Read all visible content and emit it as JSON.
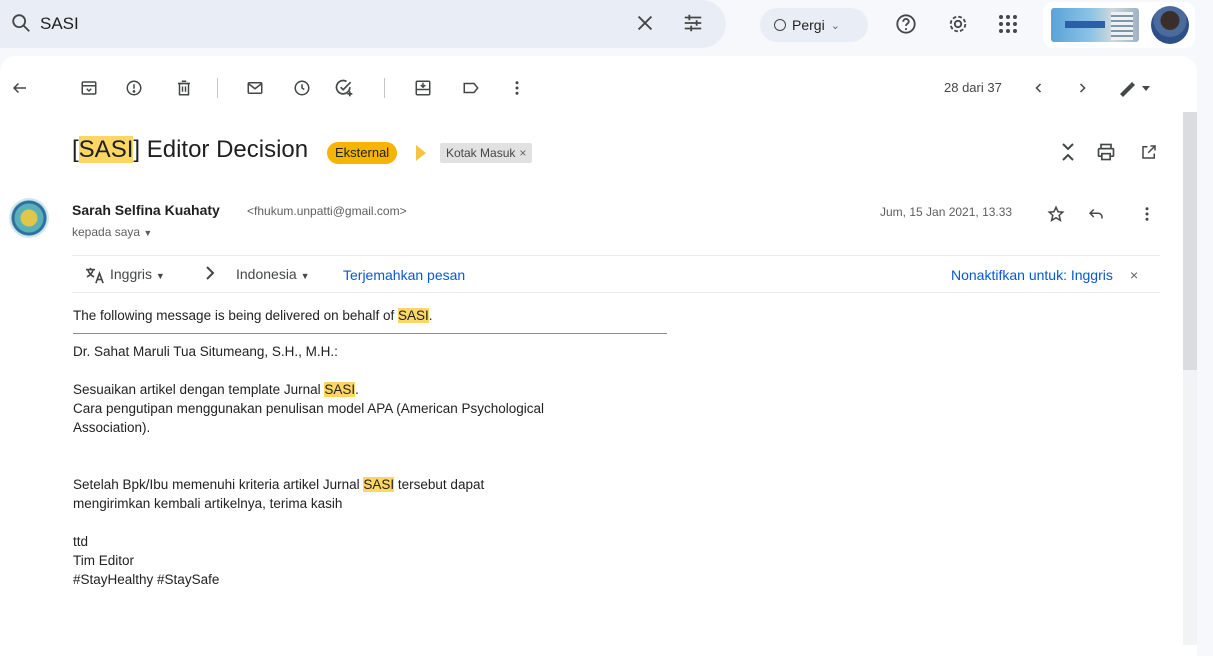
{
  "search": {
    "query": "SASI"
  },
  "status": {
    "label": "Pergi"
  },
  "toolbar": {
    "page_count": "28 dari 37"
  },
  "email": {
    "subject_prefix": "[",
    "subject_highlight": "SASI",
    "subject_rest": "] Editor Decision",
    "labels": {
      "external": "Eksternal",
      "inbox": "Kotak Masuk"
    },
    "sender_name": "Sarah Selfina Kuahaty",
    "sender_email": "<fhukum.unpatti@gmail.com>",
    "recipient": "kepada saya",
    "date": "Jum, 15 Jan 2021, 13.33"
  },
  "translate": {
    "source_lang": "Inggris",
    "target_lang": "Indonesia",
    "translate_link": "Terjemahkan pesan",
    "disable_link": "Nonaktifkan untuk: Inggris"
  },
  "body": {
    "l1_a": "The following message is being delivered on behalf of ",
    "l1_hl": "SASI",
    "l1_b": ".",
    "l2": "Dr. Sahat Maruli Tua Situmeang, S.H., M.H.:",
    "l3_a": "Sesuaikan artikel dengan template Jurnal ",
    "l3_hl": "SASI",
    "l3_b": ".",
    "l4": "Cara pengutipan menggunakan penulisan model APA (American Psychological",
    "l5": "Association).",
    "l6_a": "Setelah Bpk/Ibu memenuhi kriteria artikel Jurnal ",
    "l6_hl": "SASI",
    "l6_b": " tersebut dapat",
    "l7": "mengirimkan kembali artikelnya, terima kasih",
    "l8": "ttd",
    "l9": "Tim Editor",
    "l10": "#StayHealthy #StaySafe"
  },
  "colors": {
    "highlight": "#fdd663",
    "external_label": "#f4b400",
    "link": "#0b57d0"
  }
}
